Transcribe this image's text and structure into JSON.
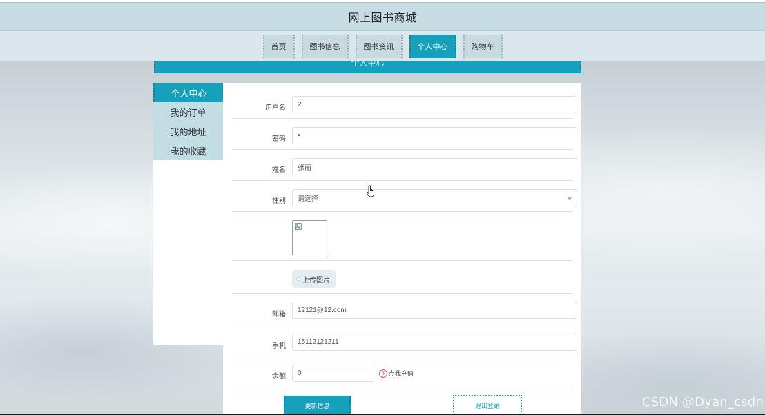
{
  "site": {
    "title": "网上图书商城"
  },
  "nav": {
    "items": [
      {
        "label": "首页",
        "active": false
      },
      {
        "label": "图书信息",
        "active": false
      },
      {
        "label": "图书资讯",
        "active": false
      },
      {
        "label": "个人中心",
        "active": true
      },
      {
        "label": "购物车",
        "active": false
      }
    ]
  },
  "section": {
    "title": "个人中心"
  },
  "sidebar": {
    "items": [
      {
        "label": "个人中心",
        "active": true
      },
      {
        "label": "我的订单",
        "active": false
      },
      {
        "label": "我的地址",
        "active": false
      },
      {
        "label": "我的收藏",
        "active": false
      }
    ]
  },
  "form": {
    "username": {
      "label": "用户名",
      "value": "2"
    },
    "password": {
      "label": "密码",
      "value": "•"
    },
    "name": {
      "label": "姓名",
      "value": "张丽"
    },
    "gender": {
      "label": "性别",
      "placeholder": "请选择"
    },
    "upload": {
      "label": "上传图片"
    },
    "email": {
      "label": "邮箱",
      "value": "12121@12.com"
    },
    "phone": {
      "label": "手机",
      "value": "15112121211"
    },
    "balance": {
      "label": "余额",
      "value": "0",
      "recharge_label": "点我充值"
    }
  },
  "actions": {
    "update_label": "更新信息",
    "logout_label": "退出登录"
  },
  "watermark": "CSDN @Dyan_csdn",
  "colors": {
    "accent": "#16a0bc",
    "header_bg": "#c7dde3",
    "nav_bg": "#dbe7ec",
    "sidebar_bg": "#c2dde3",
    "recharge_icon": "#e24b4b"
  }
}
